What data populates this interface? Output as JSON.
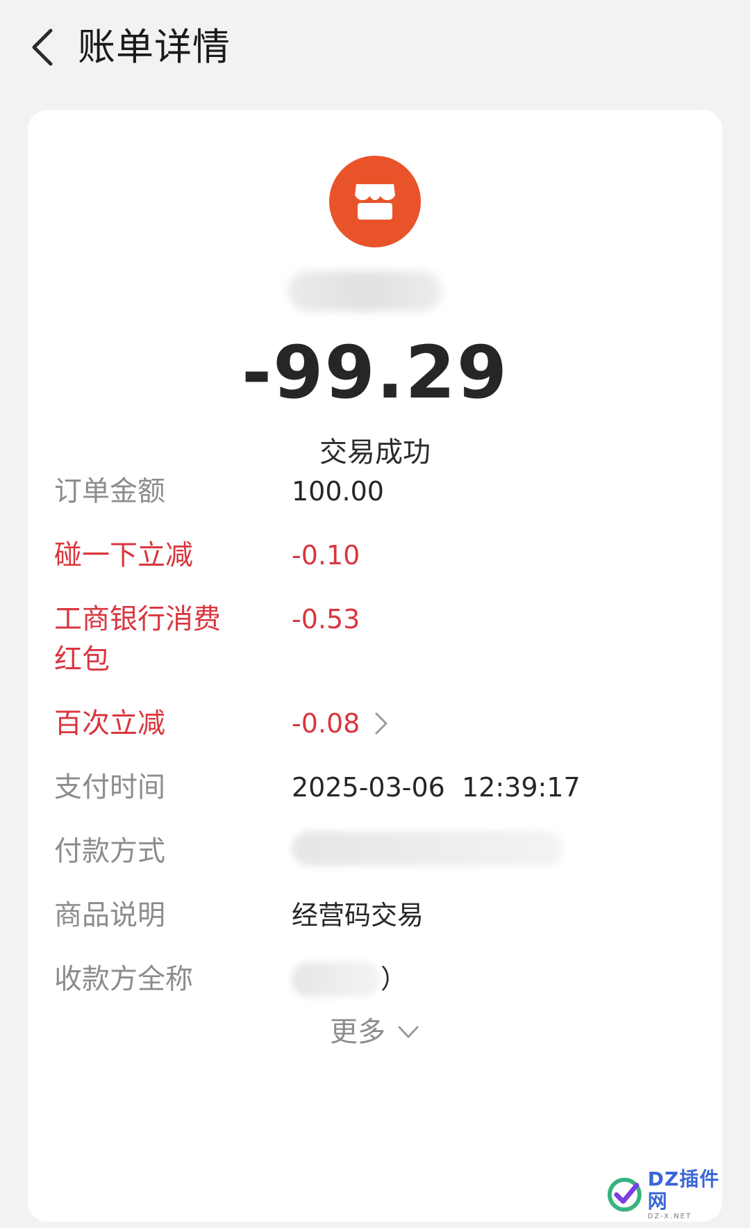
{
  "header": {
    "title": "账单详情"
  },
  "merchant": {
    "icon": "storefront-icon",
    "name": "",
    "logo_color": "#e8532a"
  },
  "amount": "-99.29",
  "status": "交易成功",
  "details": [
    {
      "label": "订单金额",
      "value": "100.00"
    },
    {
      "label": "碰一下立减",
      "value": "-0.10"
    },
    {
      "label": "工商银行消费\n红包",
      "value": "-0.53"
    },
    {
      "label": "百次立减",
      "value": "-0.08"
    },
    {
      "label": "支付时间",
      "value": "2025-03-06  12:39:17"
    },
    {
      "label": "付款方式",
      "value": ""
    },
    {
      "label": "商品说明",
      "value": "经营码交易"
    },
    {
      "label": "收款方全称",
      "value": "）"
    }
  ],
  "more": {
    "label": "更多"
  },
  "colors": {
    "discount_red": "#d9363e",
    "label_gray": "#8c8c8c",
    "accent_orange": "#e8532a"
  },
  "watermark": {
    "main": "DZ插件网",
    "sub": "DZ-X.NET"
  }
}
